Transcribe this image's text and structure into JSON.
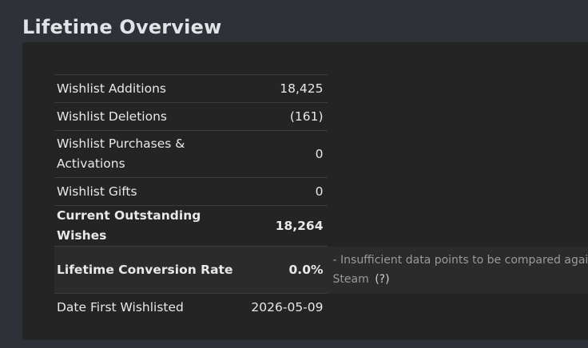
{
  "page": {
    "title": "Lifetime Overview"
  },
  "stats": {
    "rows": [
      {
        "label": "Wishlist Additions",
        "value": "18,425"
      },
      {
        "label": "Wishlist Deletions",
        "value": "(161)"
      },
      {
        "label": "Wishlist Purchases & Activations",
        "value": "0"
      },
      {
        "label": "Wishlist Gifts",
        "value": "0"
      },
      {
        "label": "Current Outstanding Wishes",
        "value": "18,264"
      },
      {
        "label": "Lifetime Conversion Rate",
        "value": "0.0%"
      },
      {
        "label": "Date First Wishlisted",
        "value": "2026-05-09"
      }
    ],
    "conversion_note_line1": "- Insufficient data points to be compared against",
    "conversion_note_line2": "Steam",
    "help_link": "(?)"
  },
  "colors": {
    "page_background": "#2f3138",
    "panel_background": "#242424",
    "note_text": "#9a9a9a"
  }
}
